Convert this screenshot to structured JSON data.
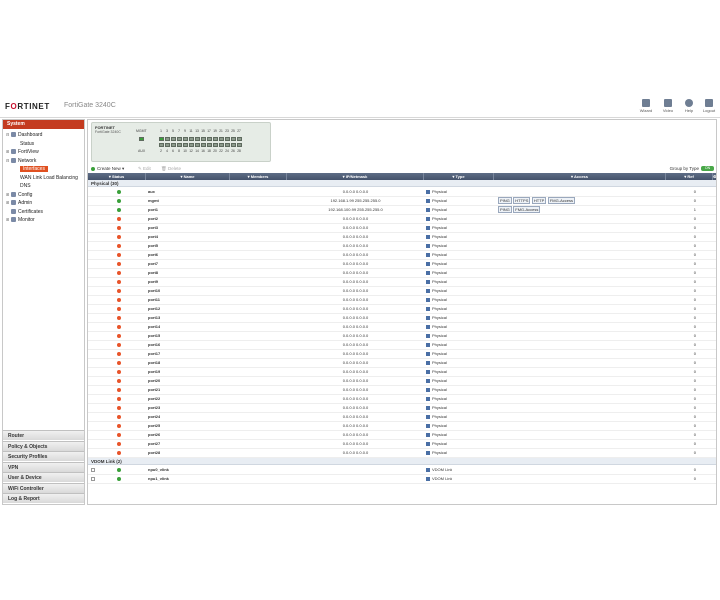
{
  "header": {
    "logo_main": "F",
    "logo_accent": "O",
    "logo_rest": "RTINET",
    "product": "FortiGate 3240C",
    "buttons": [
      {
        "label": "Wizard",
        "icon": "wizard-icon"
      },
      {
        "label": "Video",
        "icon": "video-icon"
      },
      {
        "label": "Help",
        "icon": "help-icon"
      },
      {
        "label": "Logout",
        "icon": "logout-icon"
      }
    ]
  },
  "sidebar": {
    "title": "System",
    "tree": [
      {
        "label": "Dashboard",
        "level": 0,
        "toggle": "⊟",
        "icon": "dashboard-icon"
      },
      {
        "label": "Status",
        "level": 1,
        "toggle": "",
        "icon": ""
      },
      {
        "label": "FortiView",
        "level": 0,
        "toggle": "⊞",
        "icon": "fortiview-icon"
      },
      {
        "label": "Network",
        "level": 0,
        "toggle": "⊟",
        "icon": "network-icon"
      },
      {
        "label": "Interfaces",
        "level": 1,
        "toggle": "",
        "icon": "",
        "selected": true
      },
      {
        "label": "WAN Link Load Balancing",
        "level": 1,
        "toggle": "",
        "icon": ""
      },
      {
        "label": "DNS",
        "level": 1,
        "toggle": "",
        "icon": ""
      },
      {
        "label": "Config",
        "level": 0,
        "toggle": "⊞",
        "icon": "config-icon"
      },
      {
        "label": "Admin",
        "level": 0,
        "toggle": "⊞",
        "icon": "admin-icon"
      },
      {
        "label": "Certificates",
        "level": 0,
        "toggle": "",
        "icon": "certificates-icon"
      },
      {
        "label": "Monitor",
        "level": 0,
        "toggle": "⊞",
        "icon": "monitor-icon"
      }
    ],
    "categories": [
      "Router",
      "Policy & Objects",
      "Security Profiles",
      "VPN",
      "User & Device",
      "WiFi Controller",
      "Log & Report"
    ]
  },
  "faceplate": {
    "brand": "FORTINET",
    "model": "FortiGate 3240C",
    "mgmt_label": "MGMT",
    "aux_label": "AUX",
    "top_numbers": [
      "1",
      "3",
      "5",
      "7",
      "9",
      "11",
      "13",
      "15",
      "17",
      "19",
      "21",
      "23",
      "25",
      "27"
    ],
    "bottom_numbers": [
      "2",
      "4",
      "6",
      "8",
      "10",
      "12",
      "14",
      "16",
      "18",
      "20",
      "22",
      "24",
      "26",
      "28"
    ]
  },
  "toolbar": {
    "create_new": "Create New",
    "edit": "Edit",
    "delete": "Delete",
    "group_by": "Group by Type",
    "group_toggle": "ON"
  },
  "table": {
    "columns": [
      "Status",
      "Name",
      "Members",
      "IP/Netmask",
      "Type",
      "Access",
      "Ref"
    ],
    "groups": [
      {
        "title": "Physical (30)",
        "rows": [
          {
            "status": "up",
            "name": "aux",
            "ip": "0.0.0.0 0.0.0.0",
            "type": "Physical",
            "access": [],
            "ref": "0"
          },
          {
            "status": "up",
            "name": "mgmt",
            "ip": "192.168.1.99 255.255.255.0",
            "type": "Physical",
            "access": [
              "PING",
              "HTTPS",
              "HTTP",
              "FMG-Access"
            ],
            "ref": "0"
          },
          {
            "status": "up",
            "name": "port1",
            "ip": "192.168.100.99 255.255.255.0",
            "type": "Physical",
            "access": [
              "PING",
              "FMG-Access"
            ],
            "ref": "1"
          },
          {
            "status": "down",
            "name": "port2",
            "ip": "0.0.0.0 0.0.0.0",
            "type": "Physical",
            "access": [],
            "ref": "0"
          },
          {
            "status": "down",
            "name": "port3",
            "ip": "0.0.0.0 0.0.0.0",
            "type": "Physical",
            "access": [],
            "ref": "0"
          },
          {
            "status": "down",
            "name": "port4",
            "ip": "0.0.0.0 0.0.0.0",
            "type": "Physical",
            "access": [],
            "ref": "0"
          },
          {
            "status": "down",
            "name": "port5",
            "ip": "0.0.0.0 0.0.0.0",
            "type": "Physical",
            "access": [],
            "ref": "0"
          },
          {
            "status": "down",
            "name": "port6",
            "ip": "0.0.0.0 0.0.0.0",
            "type": "Physical",
            "access": [],
            "ref": "0"
          },
          {
            "status": "down",
            "name": "port7",
            "ip": "0.0.0.0 0.0.0.0",
            "type": "Physical",
            "access": [],
            "ref": "0"
          },
          {
            "status": "down",
            "name": "port8",
            "ip": "0.0.0.0 0.0.0.0",
            "type": "Physical",
            "access": [],
            "ref": "0"
          },
          {
            "status": "down",
            "name": "port9",
            "ip": "0.0.0.0 0.0.0.0",
            "type": "Physical",
            "access": [],
            "ref": "0"
          },
          {
            "status": "down",
            "name": "port10",
            "ip": "0.0.0.0 0.0.0.0",
            "type": "Physical",
            "access": [],
            "ref": "0"
          },
          {
            "status": "down",
            "name": "port11",
            "ip": "0.0.0.0 0.0.0.0",
            "type": "Physical",
            "access": [],
            "ref": "0"
          },
          {
            "status": "down",
            "name": "port12",
            "ip": "0.0.0.0 0.0.0.0",
            "type": "Physical",
            "access": [],
            "ref": "0"
          },
          {
            "status": "down",
            "name": "port13",
            "ip": "0.0.0.0 0.0.0.0",
            "type": "Physical",
            "access": [],
            "ref": "0"
          },
          {
            "status": "down",
            "name": "port14",
            "ip": "0.0.0.0 0.0.0.0",
            "type": "Physical",
            "access": [],
            "ref": "0"
          },
          {
            "status": "down",
            "name": "port15",
            "ip": "0.0.0.0 0.0.0.0",
            "type": "Physical",
            "access": [],
            "ref": "0"
          },
          {
            "status": "down",
            "name": "port16",
            "ip": "0.0.0.0 0.0.0.0",
            "type": "Physical",
            "access": [],
            "ref": "0"
          },
          {
            "status": "down",
            "name": "port17",
            "ip": "0.0.0.0 0.0.0.0",
            "type": "Physical",
            "access": [],
            "ref": "0"
          },
          {
            "status": "down",
            "name": "port18",
            "ip": "0.0.0.0 0.0.0.0",
            "type": "Physical",
            "access": [],
            "ref": "0"
          },
          {
            "status": "down",
            "name": "port19",
            "ip": "0.0.0.0 0.0.0.0",
            "type": "Physical",
            "access": [],
            "ref": "0"
          },
          {
            "status": "down",
            "name": "port20",
            "ip": "0.0.0.0 0.0.0.0",
            "type": "Physical",
            "access": [],
            "ref": "0"
          },
          {
            "status": "down",
            "name": "port21",
            "ip": "0.0.0.0 0.0.0.0",
            "type": "Physical",
            "access": [],
            "ref": "0"
          },
          {
            "status": "down",
            "name": "port22",
            "ip": "0.0.0.0 0.0.0.0",
            "type": "Physical",
            "access": [],
            "ref": "0"
          },
          {
            "status": "down",
            "name": "port23",
            "ip": "0.0.0.0 0.0.0.0",
            "type": "Physical",
            "access": [],
            "ref": "0"
          },
          {
            "status": "down",
            "name": "port24",
            "ip": "0.0.0.0 0.0.0.0",
            "type": "Physical",
            "access": [],
            "ref": "0"
          },
          {
            "status": "down",
            "name": "port25",
            "ip": "0.0.0.0 0.0.0.0",
            "type": "Physical",
            "access": [],
            "ref": "0"
          },
          {
            "status": "down",
            "name": "port26",
            "ip": "0.0.0.0 0.0.0.0",
            "type": "Physical",
            "access": [],
            "ref": "0"
          },
          {
            "status": "down",
            "name": "port27",
            "ip": "0.0.0.0 0.0.0.0",
            "type": "Physical",
            "access": [],
            "ref": "0"
          },
          {
            "status": "down",
            "name": "port28",
            "ip": "0.0.0.0 0.0.0.0",
            "type": "Physical",
            "access": [],
            "ref": "0"
          }
        ]
      },
      {
        "title": "VDOM Link (2)",
        "rows": [
          {
            "status": "up",
            "name": "npu0_vlink",
            "ip": "",
            "type": "VDOM Link",
            "access": [],
            "ref": "0",
            "checkbox": true
          },
          {
            "status": "up",
            "name": "npu1_vlink",
            "ip": "",
            "type": "VDOM Link",
            "access": [],
            "ref": "0",
            "checkbox": true
          }
        ]
      }
    ]
  },
  "colors": {
    "accent": "#c43b20",
    "selected": "#e05020",
    "status_up": "#3aa03a",
    "status_down": "#e8542a",
    "header_bar": "#4f5e78"
  }
}
